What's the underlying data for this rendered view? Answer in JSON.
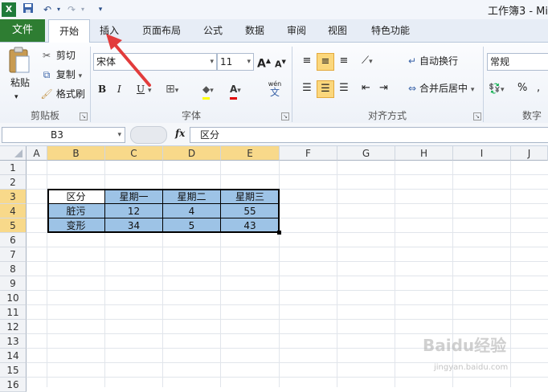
{
  "window": {
    "title": "工作簿3 - Mi"
  },
  "quick_access": {
    "excel_icon": "excel-logo-icon",
    "save_icon": "save-icon",
    "undo_icon": "undo-icon",
    "redo_icon": "redo-icon",
    "customize_icon": "customize-qat-icon"
  },
  "tabs": {
    "file": "文件",
    "home": "开始",
    "insert": "插入",
    "page_layout": "页面布局",
    "formulas": "公式",
    "data": "数据",
    "review": "审阅",
    "view": "视图",
    "special": "特色功能"
  },
  "clipboard": {
    "paste": "粘贴",
    "cut": "剪切",
    "copy": "复制",
    "format_painter": "格式刷",
    "group": "剪贴板"
  },
  "font": {
    "name": "宋体",
    "size": "11",
    "bold": "B",
    "italic": "I",
    "underline": "U",
    "group": "字体",
    "grow": "A",
    "shrink": "A",
    "wen": "wén",
    "wen_char": "文"
  },
  "alignment": {
    "wrap": "自动换行",
    "merge": "合并后居中",
    "group": "对齐方式"
  },
  "number": {
    "format": "常规",
    "percent": "%",
    "group": "数字"
  },
  "formula_bar": {
    "name_box": "B3",
    "fx": "fx",
    "content": "区分"
  },
  "columns": [
    "A",
    "B",
    "C",
    "D",
    "E",
    "F",
    "G",
    "H",
    "I",
    "J"
  ],
  "rows": [
    "1",
    "2",
    "3",
    "4",
    "5",
    "6",
    "7",
    "8",
    "9",
    "10",
    "11",
    "12",
    "13",
    "14",
    "15",
    "16"
  ],
  "table": {
    "header": [
      "区分",
      "星期一",
      "星期二",
      "星期三"
    ],
    "rows": [
      [
        "脏污",
        "12",
        "4",
        "55"
      ],
      [
        "变形",
        "34",
        "5",
        "43"
      ]
    ]
  },
  "colors": {
    "file_tab": "#2e7d32",
    "header_fill": "#9dc3e6",
    "selection_header": "#f8d98a",
    "arrow": "#e23c3c"
  },
  "watermark": {
    "text": "Baidu经验",
    "url": "jingyan.baidu.com"
  }
}
